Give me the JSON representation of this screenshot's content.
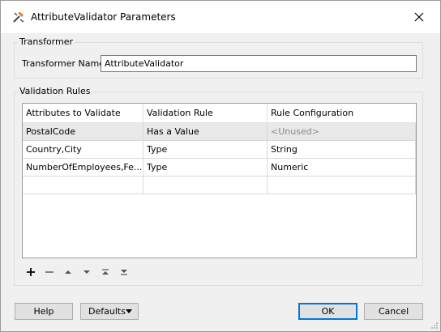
{
  "window": {
    "title": "AttributeValidator Parameters",
    "icon": "attribute-validator-icon",
    "close_icon": "close-icon"
  },
  "transformer": {
    "group_title": "Transformer",
    "name_label": "Transformer Name:",
    "name_value": "AttributeValidator"
  },
  "validation_rules": {
    "group_title": "Validation Rules",
    "columns": [
      "Attributes to Validate",
      "Validation Rule",
      "Rule Configuration"
    ],
    "rows": [
      {
        "attributes": "PostalCode",
        "rule": "Has a Value",
        "config": "<Unused>"
      },
      {
        "attributes": "Country,City",
        "rule": "Type",
        "config": "String"
      },
      {
        "attributes": "NumberOfEmployees,Fe...",
        "rule": "Type",
        "config": "Numeric"
      },
      {
        "attributes": "",
        "rule": "",
        "config": ""
      }
    ],
    "toolbar": [
      "add-icon",
      "remove-icon",
      "move-up-icon",
      "move-down-icon",
      "move-to-top-icon",
      "move-to-bottom-icon"
    ]
  },
  "buttons": {
    "help": "Help",
    "defaults": "Defaults",
    "ok": "OK",
    "cancel": "Cancel"
  },
  "colors": {
    "window_bg": "#f0f0f0",
    "selected_row": "#e8e8e8",
    "unused_text": "#8a8a8a",
    "focus_border": "#0078d7"
  }
}
